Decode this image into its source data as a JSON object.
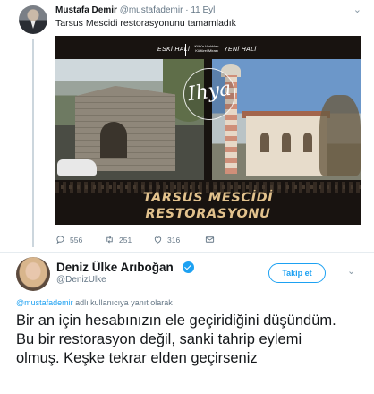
{
  "parent_tweet": {
    "name": "Mustafa Demir",
    "handle": "@mustafademir",
    "separator": "·",
    "date": "11 Eyl",
    "text": "Tarsus Mescidi restorasyonunu tamamladık",
    "image": {
      "label_old": "ESKİ HALİ",
      "label_new": "YENİ HALİ",
      "label_small": "Kültür Varlıkları Kültürel Mirası",
      "logo_text": "Ihya",
      "title_line1": "TARSUS MESCİDİ",
      "title_line2": "RESTORASYONU"
    },
    "actions": {
      "replies": "556",
      "retweets": "251",
      "likes": "316"
    }
  },
  "reply_tweet": {
    "name": "Deniz Ülke Arıboğan",
    "handle": "@DenizUlke",
    "follow_label": "Takip et",
    "replying_to_mention": "@mustafademir",
    "replying_to_suffix": " adlı kullanıcıya yanıt olarak",
    "text": "Bir an için hesabınızın ele geçiridiğini düşündüm. Bu bir restorasyon değil, sanki tahrip eylemi olmuş. Keşke tekrar elden geçirseniz"
  },
  "colors": {
    "accent": "#1da1f2",
    "secondary_text": "#657786",
    "title_gold": "#e2c28d"
  }
}
